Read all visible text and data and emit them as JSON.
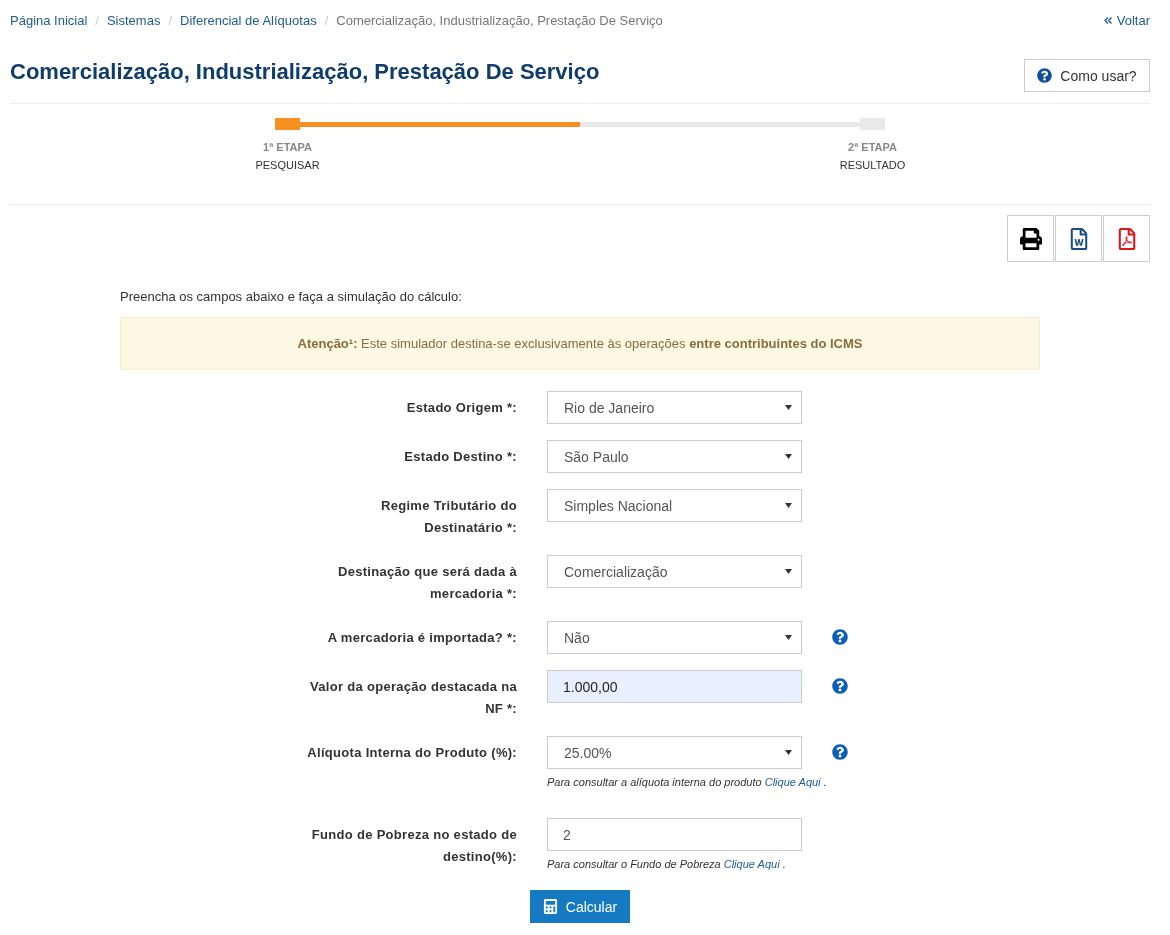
{
  "breadcrumb": {
    "separator": "/",
    "items": [
      {
        "label": "Página Inicial",
        "current": false
      },
      {
        "label": "Sistemas",
        "current": false
      },
      {
        "label": "Diferencial de Alíquotas",
        "current": false
      },
      {
        "label": "Comercialização, Industrialização, Prestação De Serviço",
        "current": true
      }
    ]
  },
  "back_link": {
    "label": "Voltar"
  },
  "page_title": "Comercialização, Industrialização, Prestação De Serviço",
  "help_button": {
    "label": "Como usar?"
  },
  "progress": {
    "level": 0.5
  },
  "steps": [
    {
      "number": "1ª ETAPA",
      "name": "PESQUISAR",
      "selected": true
    },
    {
      "number": "2ª ETAPA",
      "name": "RESULTADO",
      "selected": false
    }
  ],
  "export_buttons": [
    {
      "kind": "print"
    },
    {
      "kind": "word"
    },
    {
      "kind": "pdf"
    }
  ],
  "intro": "Preencha os campos abaixo e faça a simulação do cálculo:",
  "alert": "**Atenção¹:** Este simulador destina-se exclusivamente às operações **entre contribuintes do ICMS**",
  "fields": [
    {
      "label": "Estado Origem *:",
      "kind": "select",
      "value": "Rio de Janeiro",
      "autofilled": false,
      "help": false
    },
    {
      "label": "Estado Destino *:",
      "kind": "select",
      "value": "São Paulo",
      "autofilled": false,
      "help": false
    },
    {
      "label": "Regime Tributário do Destinatário *:",
      "kind": "select",
      "value": "Simples Nacional",
      "autofilled": false,
      "help": false
    },
    {
      "label": "Destinação que será dada à mercadoria *:",
      "kind": "select",
      "value": "Comercialização",
      "autofilled": false,
      "help": false
    },
    {
      "label": "A mercadoria é importada? *:",
      "kind": "select",
      "value": "Não",
      "autofilled": false,
      "help": true
    },
    {
      "label": "Valor da operação destacada na NF *:",
      "kind": "input",
      "value": "1.000,00",
      "autofilled": true,
      "help": true
    },
    {
      "label": "Alíquota Interna do Produto (%):",
      "kind": "select",
      "value": "25.00%",
      "autofilled": false,
      "help": true,
      "hint": {
        "text": "Para consultar a alíquota interna do produto",
        "link": "Clique Aqui",
        "end": "."
      }
    },
    {
      "label": "Fundo de Pobreza no estado de destino(%):",
      "kind": "input",
      "value": "2",
      "autofilled": false,
      "help": false,
      "hint": {
        "text": "Para consultar o Fundo de Pobreza",
        "link": "Clique Aqui",
        "end": "."
      }
    }
  ],
  "submit_button": {
    "label": "Calcular"
  }
}
